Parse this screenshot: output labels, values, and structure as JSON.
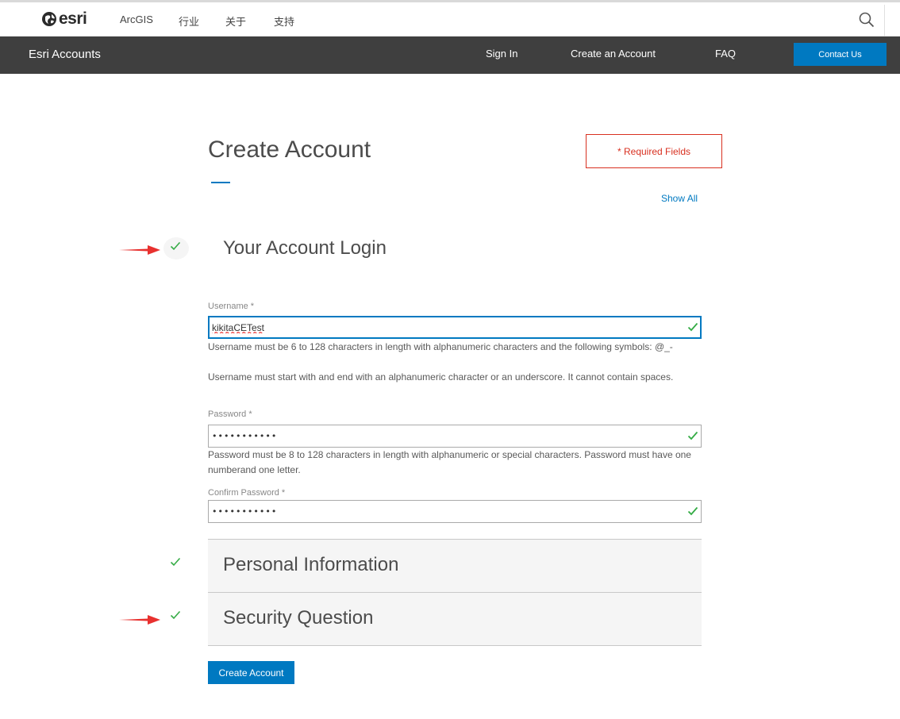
{
  "topbar": {
    "logo_text": "esri",
    "nav": [
      "ArcGIS",
      "行业",
      "关于",
      "支持"
    ]
  },
  "subnav": {
    "brand": "Esri Accounts",
    "links": [
      "Sign In",
      "Create an Account",
      "FAQ"
    ],
    "contact_label": "Contact Us"
  },
  "page": {
    "title": "Create Account",
    "required_note": "* Required Fields",
    "show_all": "Show All"
  },
  "login_section": {
    "title": "Your Account Login",
    "username": {
      "label": "Username *",
      "value": "kikitaCETest",
      "help1": "Username must be 6 to 128 characters in length with alphanumeric characters and the following symbols: @_-",
      "help2": "Username must start with and end with an alphanumeric character or an underscore. It cannot contain spaces."
    },
    "password": {
      "label": "Password *",
      "value": "•••••••••••",
      "help": "Password must be 8 to 128 characters in length with alphanumeric or special characters. Password must have one numberand one letter."
    },
    "confirm_password": {
      "label": "Confirm Password *",
      "value": "•••••••••••"
    }
  },
  "sections": {
    "personal": "Personal Information",
    "security": "Security Question"
  },
  "submit_label": "Create Account",
  "colors": {
    "accent": "#0079c1",
    "required": "#d83020",
    "check": "#35ac46",
    "arrow": "#e8312f",
    "subnav_bg": "#3f3f3f"
  },
  "icons": [
    "esri-globe-icon",
    "search-icon",
    "check-icon",
    "red-arrow-icon"
  ]
}
